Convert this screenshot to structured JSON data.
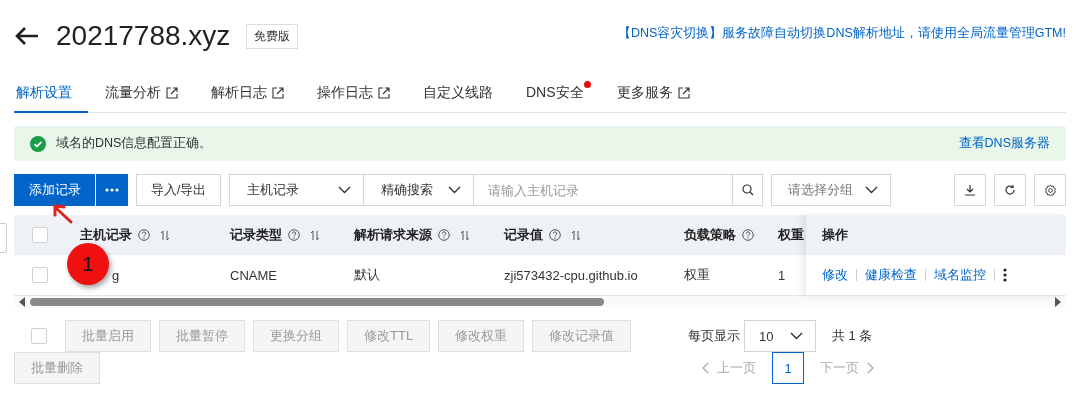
{
  "header": {
    "title": "20217788.xyz",
    "edition_badge": "免费版",
    "promo_link": "【DNS容灾切换】服务故障自动切换DNS解析地址，请使用全局流量管理GTM!"
  },
  "tabs": [
    {
      "label": "解析设置",
      "selected": true,
      "external": false,
      "dot": false
    },
    {
      "label": "流量分析",
      "selected": false,
      "external": true,
      "dot": false
    },
    {
      "label": "解析日志",
      "selected": false,
      "external": true,
      "dot": false
    },
    {
      "label": "操作日志",
      "selected": false,
      "external": true,
      "dot": false
    },
    {
      "label": "自定义线路",
      "selected": false,
      "external": false,
      "dot": false
    },
    {
      "label": "DNS安全",
      "selected": false,
      "external": false,
      "dot": true
    },
    {
      "label": "更多服务",
      "selected": false,
      "external": true,
      "dot": false
    }
  ],
  "alert": {
    "message": "域名的DNS信息配置正确。",
    "link": "查看DNS服务器"
  },
  "toolbar": {
    "primary_button": "添加记录",
    "import_export": "导入/导出",
    "field_select": "主机记录",
    "match_select": "精确搜索",
    "search": {
      "placeholder": "请输入主机记录"
    },
    "group_select": {
      "placeholder": "请选择分组"
    }
  },
  "table": {
    "header_checked": false,
    "columns": [
      {
        "label": "主机记录",
        "help": true,
        "sortable": true
      },
      {
        "label": "记录类型",
        "help": true,
        "sortable": true
      },
      {
        "label": "解析请求来源",
        "help": true,
        "sortable": true
      },
      {
        "label": "记录值",
        "help": true,
        "sortable": true
      },
      {
        "label": "负载策略",
        "help": true,
        "sortable": false
      },
      {
        "label": "权重",
        "help": false,
        "sortable": false
      }
    ],
    "actions_column": "操作",
    "rows": [
      {
        "selected": false,
        "cells": [
          "g",
          "CNAME",
          "默认",
          "zji573432-cpu.github.io",
          "权重",
          "1"
        ],
        "actions": [
          "修改",
          "健康检查",
          "域名监控"
        ]
      }
    ]
  },
  "bulk": {
    "checked": false,
    "buttons": [
      {
        "label": "批量启用",
        "disabled": true
      },
      {
        "label": "批量暂停",
        "disabled": true
      },
      {
        "label": "更换分组",
        "disabled": true
      },
      {
        "label": "修改TTL",
        "disabled": true
      },
      {
        "label": "修改权重",
        "disabled": true
      },
      {
        "label": "修改记录值",
        "disabled": true
      },
      {
        "label": "批量删除",
        "disabled": true
      }
    ]
  },
  "pagination": {
    "page_size_label": "每页显示",
    "page_size": "10",
    "total": "共 1 条",
    "prev": {
      "label": "上一页",
      "disabled": true
    },
    "next": {
      "label": "下一页",
      "disabled": true
    },
    "pages": [
      {
        "label": "1",
        "selected": true
      }
    ]
  },
  "annotation": {
    "badge": "1"
  }
}
